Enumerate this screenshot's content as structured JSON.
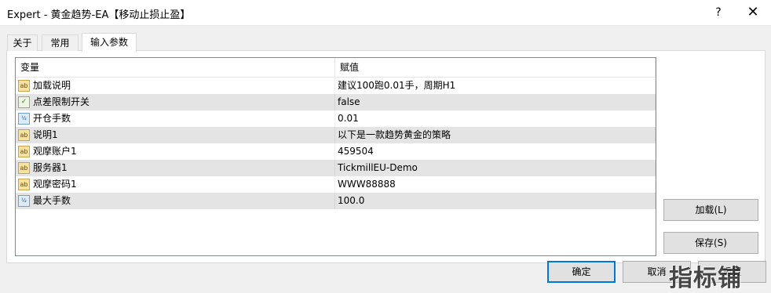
{
  "window": {
    "title": "Expert - 黄金趋势-EA【移动止损止盈】",
    "help_label": "?",
    "close_label": "✕"
  },
  "tabs": [
    {
      "label": "关于"
    },
    {
      "label": "常用"
    },
    {
      "label": "输入参数"
    }
  ],
  "active_tab": "输入参数",
  "table": {
    "columns": [
      "变量",
      "赋值"
    ],
    "rows": [
      {
        "variable": "加载说明",
        "value": "建议100跑0.01手，周期H1",
        "type_icon": "string-icon",
        "icon_text": "ab"
      },
      {
        "variable": "点差限制开关",
        "value": "false",
        "type_icon": "bool-icon",
        "icon_text": "✓"
      },
      {
        "variable": "开仓手数",
        "value": "0.01",
        "type_icon": "number-icon",
        "icon_text": "½"
      },
      {
        "variable": "说明1",
        "value": "以下是一款趋势黄金的策略",
        "type_icon": "string-icon",
        "icon_text": "ab"
      },
      {
        "variable": "观摩账户1",
        "value": "459504",
        "type_icon": "string-icon",
        "icon_text": "ab"
      },
      {
        "variable": "服务器1",
        "value": "TickmillEU-Demo",
        "type_icon": "string-icon",
        "icon_text": "ab"
      },
      {
        "variable": "观摩密码1",
        "value": "WWW88888",
        "type_icon": "string-icon",
        "icon_text": "ab"
      },
      {
        "variable": "最大手数",
        "value": "100.0",
        "type_icon": "number-icon",
        "icon_text": "½"
      }
    ]
  },
  "buttons": {
    "load": "加载(L)",
    "save": "保存(S)",
    "ok": "确定",
    "cancel": "取消",
    "reset": "重置"
  },
  "watermark": "指标铺",
  "colors": {
    "alt_row": "#e4e4e4",
    "focus_border": "#0078d7"
  }
}
